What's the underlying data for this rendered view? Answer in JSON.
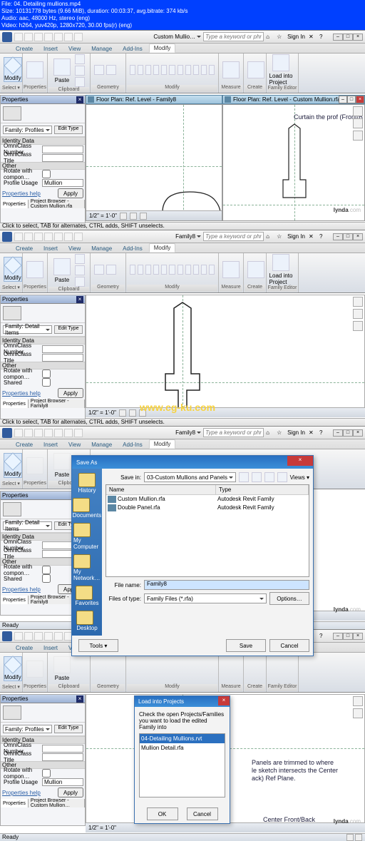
{
  "video_info": {
    "file": "File:  04. Detailing mullions.mp4",
    "size": "Size: 10131778 bytes (9.66 MiB), duration: 00:03:37, avg.bitrate: 374 kb/s",
    "audio": "Audio: aac, 48000 Hz, stereo (eng)",
    "video": "Video: h264, yuv420p, 1280x720, 30.00 fps(r) (eng)"
  },
  "yellow_watermark": "www.cg-ku.com",
  "watermark_bold": "lynda",
  "watermark_rest": ".com",
  "common": {
    "search_placeholder": "Type a keyword or phrase",
    "signin": "Sign In",
    "tabs": {
      "create": "Create",
      "insert": "Insert",
      "view": "View",
      "manage": "Manage",
      "addins": "Add-Ins",
      "modify": "Modify"
    },
    "qat_items": [
      "new",
      "open",
      "save",
      "undo",
      "redo",
      "print",
      "opt1"
    ],
    "doc_dd_label": "Custom Mullio…",
    "ribbon_groups": {
      "select": "Select ▾",
      "properties": "Properties",
      "clipboard": "Clipboard",
      "geometry": "Geometry",
      "modify": "Modify",
      "measure": "Measure",
      "create": "Create",
      "family": "Family Editor"
    },
    "ribbon_btns": {
      "modify": "Modify",
      "properties": "",
      "paste": "Paste",
      "cut": "Cut",
      "copy": "Copy",
      "join": "Join",
      "load": "Load into\nProject"
    },
    "props_title": "Properties",
    "edit_type": "Edit Type",
    "identity_data": "Identity Data",
    "omni_number": "OmniClass Number",
    "omni_title": "OmniClass Title",
    "other": "Other",
    "rotate_with": "Rotate with compon…",
    "profile_usage": "Profile Usage",
    "profile_usage_val": "Mullion",
    "shared": "Shared",
    "properties_help": "Properties help",
    "apply": "Apply",
    "btab_props": "Properties",
    "btab_pb1": "Project Browser - Custom Mullion.rfa",
    "btab_pb2": "Project Browser - Family8",
    "hint": "Click to select, TAB for alternates, CTRL adds, SHIFT unselects.",
    "ready": "Ready",
    "scale": "1/2\" = 1'-0\"",
    "doc2_label": "Family8"
  },
  "pane1": {
    "type_sel": "Family: Profiles",
    "view_tabs": {
      "left": "Floor Plan: Ref. Level  - Family8",
      "right": "Floor Plan: Ref. Level  - Custom Mullion.rfa"
    },
    "anno": "Curtain\nthe prof\n(Front/B"
  },
  "pane2": {
    "type_sel": "Family: Detail Items"
  },
  "pane3": {
    "type_sel": "Family: Detail Items",
    "saveas": {
      "title": "Save As",
      "savein_label": "Save in:",
      "savein_value": "03-Custom Mullions and Panels",
      "views_label": "Views ▾",
      "cols": {
        "name": "Name",
        "type": "Type"
      },
      "rows": [
        {
          "name": "Custom Mullion.rfa",
          "type": "Autodesk Revit Family"
        },
        {
          "name": "Double Panel.rfa",
          "type": "Autodesk Revit Family"
        }
      ],
      "filename_label": "File name:",
      "filename_value": "Family8",
      "filetype_label": "Files of type:",
      "filetype_value": "Family Files (*.rfa)",
      "tools": "Tools ▾",
      "options": "Options…",
      "save": "Save",
      "cancel": "Cancel",
      "places": [
        {
          "l": "History"
        },
        {
          "l": "Documents"
        },
        {
          "l": "My Computer"
        },
        {
          "l": "My Network…"
        },
        {
          "l": "Favorites"
        },
        {
          "l": "Desktop"
        }
      ]
    }
  },
  "pane4": {
    "type_sel": "Family: Profiles",
    "btab_pb": "Project Browser - Custom Mullion…",
    "load_dlg": {
      "title": "Load into Projects",
      "msg": "Check the open Projects/Families you want to load the edited Family into",
      "items": [
        "04-Detailing Mullions.rvt",
        "Mullion Detail.rfa"
      ],
      "ok": "OK",
      "cancel": "Cancel"
    },
    "anno1": "Panels are trimmed to where\nle sketch intersects the Center\nack) Ref Plane.",
    "anno2": "Center Front/Back\nReference Plane"
  }
}
